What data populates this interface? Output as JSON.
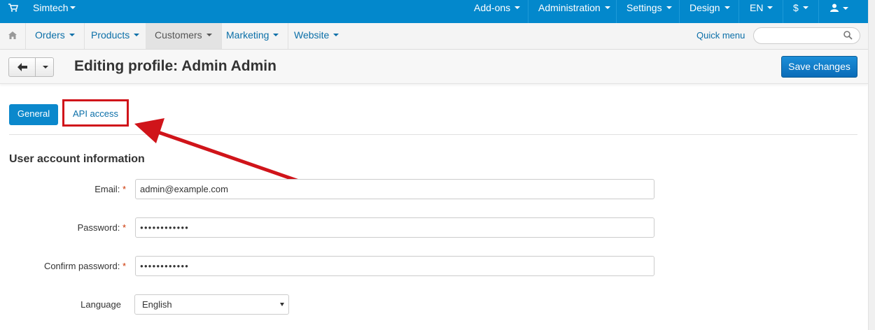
{
  "topbar": {
    "cart_icon": "cart-icon",
    "store": "Simtech",
    "menu": [
      {
        "label": "Add-ons"
      },
      {
        "label": "Administration"
      },
      {
        "label": "Settings"
      },
      {
        "label": "Design"
      },
      {
        "label": "EN"
      },
      {
        "label": "$"
      }
    ],
    "user_icon": "user-icon"
  },
  "nav": {
    "home_icon": "home-icon",
    "items": [
      {
        "label": "Orders"
      },
      {
        "label": "Products"
      },
      {
        "label": "Customers"
      },
      {
        "label": "Marketing"
      },
      {
        "label": "Website"
      }
    ],
    "active": "Customers",
    "quick_menu": "Quick menu",
    "search_placeholder": ""
  },
  "header": {
    "title": "Editing profile: Admin Admin",
    "save_label": "Save changes"
  },
  "tabs": {
    "general": "General",
    "api": "API access"
  },
  "section": {
    "title": "User account information"
  },
  "form": {
    "email_label": "Email:",
    "email_value": "admin@example.com",
    "password_label": "Password:",
    "password_value": "●●●●●●●●●●●●",
    "confirm_label": "Confirm password:",
    "confirm_value": "●●●●●●●●●●●●",
    "required_mark": "*",
    "language_label": "Language",
    "language_value": "English"
  },
  "colors": {
    "topbar": "#0388cc",
    "accent": "#0b88cc",
    "annotation": "#d0141a"
  }
}
